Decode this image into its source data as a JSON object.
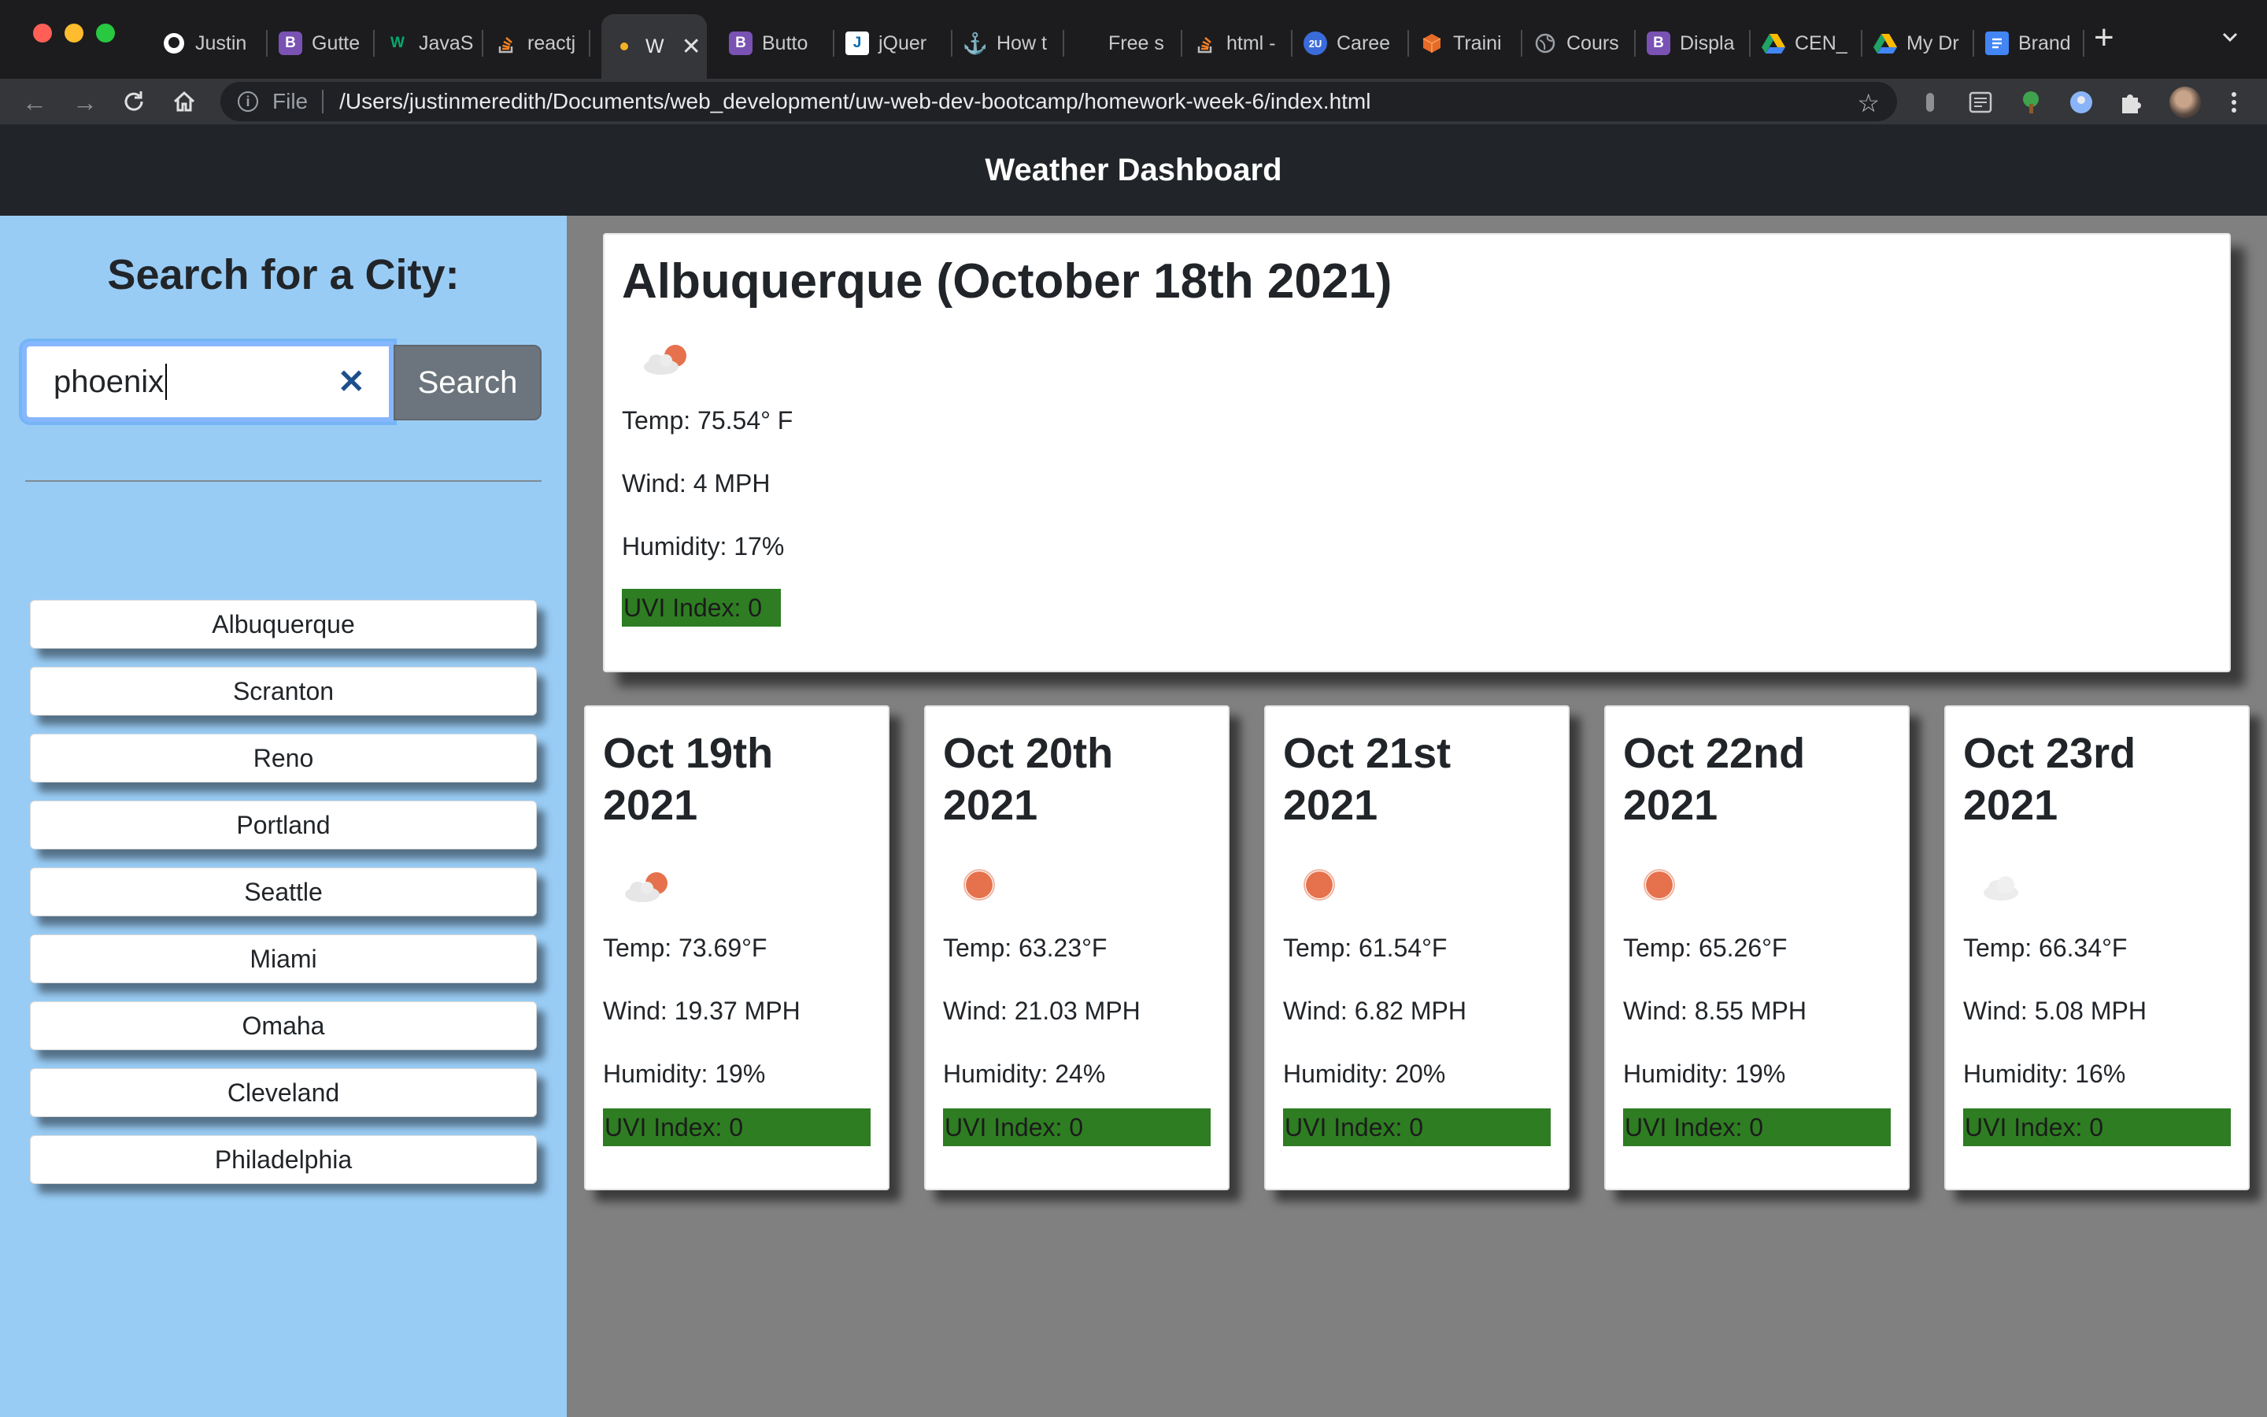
{
  "browser": {
    "tabs": [
      {
        "label": "Justin",
        "icon": "github-icon",
        "color": "#ffffff"
      },
      {
        "label": "Gutte",
        "icon": "bootstrap-icon",
        "color": "#7952b3"
      },
      {
        "label": "JavaS",
        "icon": "w3schools-icon",
        "color": "#04aa6d"
      },
      {
        "label": "reactj",
        "icon": "stackoverflow-icon",
        "color": "#f48024"
      },
      {
        "label": "W",
        "icon": "dot-icon",
        "color": "#f5b324",
        "active": true
      },
      {
        "label": "Butto",
        "icon": "bootstrap-icon",
        "color": "#7952b3"
      },
      {
        "label": "jQuer",
        "icon": "jquery-icon",
        "color": "#0769ad"
      },
      {
        "label": "How t",
        "icon": "anchor-icon",
        "color": "#c9cacc"
      },
      {
        "label": "Free s",
        "icon": "blank-icon",
        "color": "#1c1c1e"
      },
      {
        "label": "html -",
        "icon": "stackoverflow-icon",
        "color": "#f48024"
      },
      {
        "label": "Caree",
        "icon": "2u-icon",
        "color": "#3b6bdb"
      },
      {
        "label": "Traini",
        "icon": "cube-icon",
        "color": "#e66a28"
      },
      {
        "label": "Cours",
        "icon": "globe-icon",
        "color": "#8e8f92"
      },
      {
        "label": "Displa",
        "icon": "bootstrap-icon",
        "color": "#7952b3"
      },
      {
        "label": "CEN_",
        "icon": "drive-icon",
        "color": "#1fa463"
      },
      {
        "label": "My Dr",
        "icon": "drive-icon",
        "color": "#1fa463"
      },
      {
        "label": "Brand",
        "icon": "docs-icon",
        "color": "#4285f4"
      }
    ],
    "address": {
      "scheme_label": "File",
      "url": "/Users/justinmeredith/Documents/web_development/uw-web-dev-bootcamp/homework-week-6/index.html"
    }
  },
  "header": {
    "title": "Weather Dashboard"
  },
  "sidebar": {
    "heading": "Search for a City:",
    "search": {
      "value": "phoenix",
      "button_label": "Search"
    },
    "history": [
      "Albuquerque",
      "Scranton",
      "Reno",
      "Portland",
      "Seattle",
      "Miami",
      "Omaha",
      "Cleveland",
      "Philadelphia"
    ]
  },
  "current": {
    "title": "Albuquerque (October 18th 2021)",
    "icon": "partly-cloudy-icon",
    "temp": "Temp: 75.54° F",
    "wind": "Wind: 4 MPH",
    "humidity": "Humidity: 17%",
    "uvi": "UVI Index: 0"
  },
  "forecast": [
    {
      "date": "Oct 19th 2021",
      "icon": "partly-cloudy-icon",
      "temp": "Temp: 73.69°F",
      "wind": "Wind: 19.37 MPH",
      "humidity": "Humidity: 19%",
      "uvi": "UVI Index: 0"
    },
    {
      "date": "Oct 20th 2021",
      "icon": "sun-icon",
      "temp": "Temp: 63.23°F",
      "wind": "Wind: 21.03 MPH",
      "humidity": "Humidity: 24%",
      "uvi": "UVI Index: 0"
    },
    {
      "date": "Oct 21st 2021",
      "icon": "sun-icon",
      "temp": "Temp: 61.54°F",
      "wind": "Wind: 6.82 MPH",
      "humidity": "Humidity: 20%",
      "uvi": "UVI Index: 0"
    },
    {
      "date": "Oct 22nd 2021",
      "icon": "sun-icon",
      "temp": "Temp: 65.26°F",
      "wind": "Wind: 8.55 MPH",
      "humidity": "Humidity: 19%",
      "uvi": "UVI Index: 0"
    },
    {
      "date": "Oct 23rd 2021",
      "icon": "cloud-icon",
      "temp": "Temp: 66.34°F",
      "wind": "Wind: 5.08 MPH",
      "humidity": "Humidity: 16%",
      "uvi": "UVI Index: 0"
    }
  ],
  "colors": {
    "sidebar_bg": "#99ccf5",
    "header_bg": "#212529",
    "uvi_low": "#2e7d22",
    "sun": "#e5724d"
  }
}
